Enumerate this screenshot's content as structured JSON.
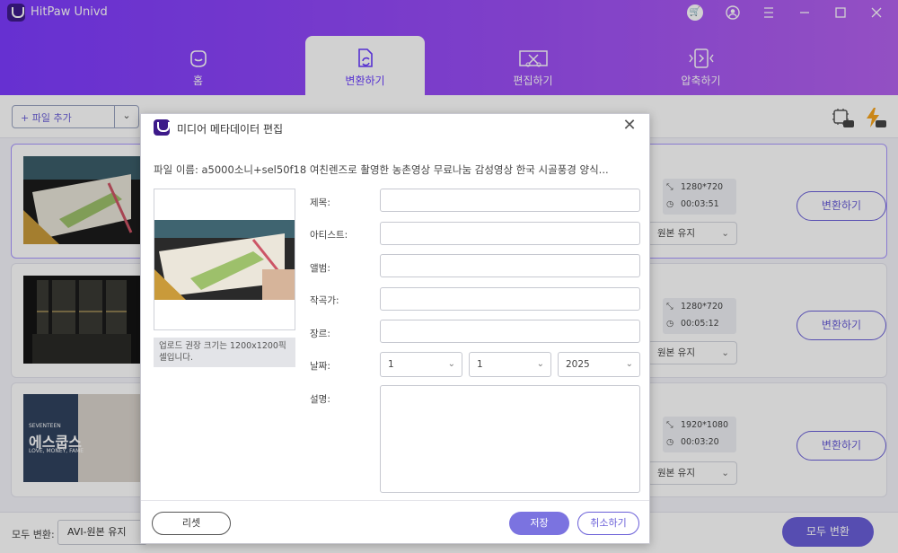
{
  "app": {
    "title": "HitPaw Univd"
  },
  "tabs": [
    {
      "label": "홈",
      "icon": "home-icon"
    },
    {
      "label": "변환하기",
      "icon": "convert-icon"
    },
    {
      "label": "편집하기",
      "icon": "edit-icon"
    },
    {
      "label": "압축하기",
      "icon": "compress-icon"
    }
  ],
  "toolbar": {
    "add_file_label": "+ 파일 추가"
  },
  "files": [
    {
      "resolution": "1280*720",
      "duration": "00:03:51",
      "format": "원본 유지",
      "convert_label": "변환하기",
      "partial": "3"
    },
    {
      "resolution": "1280*720",
      "duration": "00:05:12",
      "format": "원본 유지",
      "convert_label": "변환하기",
      "partial": "3"
    },
    {
      "resolution": "1920*1080",
      "duration": "00:03:20",
      "format": "원본 유지",
      "convert_label": "변환하기",
      "partial": "3"
    }
  ],
  "footer": {
    "convert_all_label": "모두 변환:",
    "convert_all_format": "AVI-원본 유지",
    "convert_all_button": "모두 변환"
  },
  "thumb3": {
    "brand": "SEVENTEEN",
    "title": "에스쿱스",
    "subtitle": "LOVE, MONEY, FAME"
  },
  "dialog": {
    "title": "미디어 메타데이터 편집",
    "filename": "파일 이름: a5000소니+sel50f18 여친렌즈로 촬영한 농촌영상 무료나눔 감성영상 한국 시골풍경 양식...",
    "cover_note": "업로드 권장 크기는 1200x1200픽셀입니다.",
    "fields": {
      "title": "제목:",
      "artist": "아티스트:",
      "album": "앨범:",
      "composer": "작곡가:",
      "genre": "장르:",
      "date": "날짜:",
      "description": "설명:"
    },
    "date": {
      "month": "1",
      "day": "1",
      "year": "2025"
    },
    "buttons": {
      "reset": "리셋",
      "save": "저장",
      "cancel": "취소하기"
    }
  }
}
